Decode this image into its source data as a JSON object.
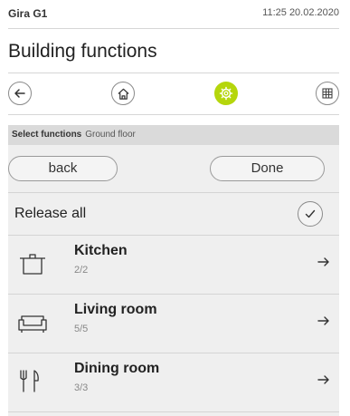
{
  "status_bar": {
    "device": "Gira G1",
    "datetime": "11:25 20.02.2020"
  },
  "page": {
    "title": "Building functions"
  },
  "nav": {
    "back_icon": "arrow-left-icon",
    "home_icon": "home-icon",
    "settings_icon": "gear-icon",
    "grid_icon": "grid-icon",
    "active_color": "#b5d60c"
  },
  "panel": {
    "header_bold": "Select functions",
    "header_location": "Ground floor",
    "back_label": "back",
    "done_label": "Done",
    "release_all_label": "Release all",
    "rooms": [
      {
        "name": "Kitchen",
        "count": "2/2",
        "icon": "pot-icon"
      },
      {
        "name": "Living room",
        "count": "5/5",
        "icon": "sofa-icon"
      },
      {
        "name": "Dining room",
        "count": "3/3",
        "icon": "fork-knife-icon"
      }
    ]
  }
}
